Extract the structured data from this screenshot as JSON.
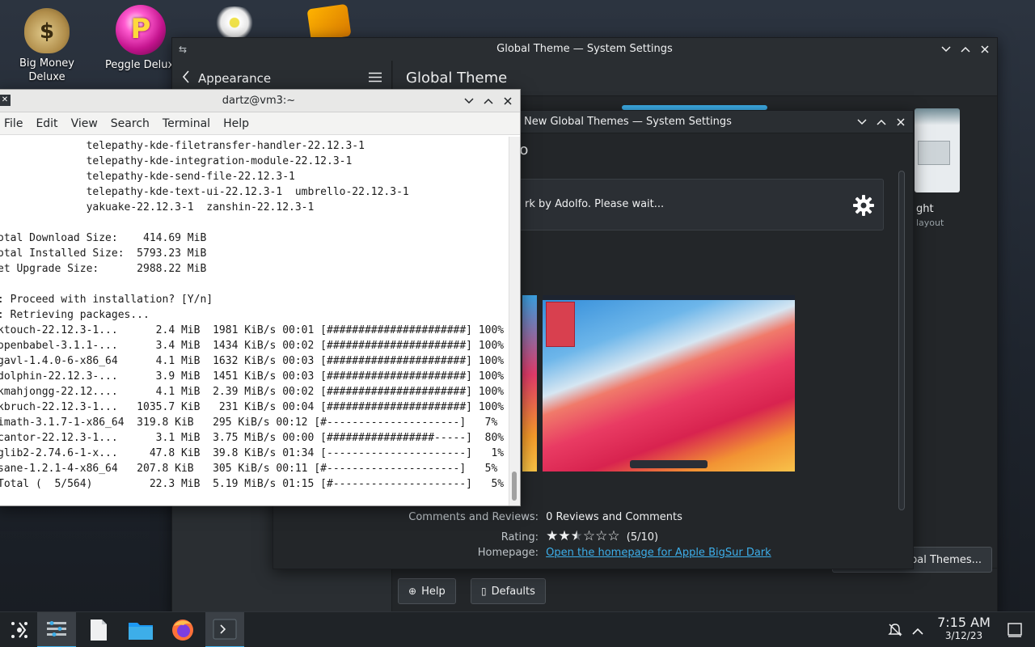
{
  "desktop": {
    "icons": [
      {
        "label": "Big Money Deluxe"
      },
      {
        "label": "Peggle Deluxe"
      }
    ]
  },
  "system_settings": {
    "window_title": "Global Theme — System Settings",
    "sidebar_title": "Appearance",
    "page_title": "Global Theme",
    "right_card_label": "ght",
    "right_card_sublabel": "layout",
    "get_new_button": "obal Themes...",
    "help_button": "Help",
    "defaults_button": "Defaults"
  },
  "ghns_dialog": {
    "window_title": "New Global Themes — System Settings",
    "heading_fragment": "fo",
    "status_message": "rk by Adolfo. Please wait...",
    "comments_label": "Comments and Reviews:",
    "comments_value": "0 Reviews and Comments",
    "rating_label": "Rating:",
    "rating_value": "(5/10)",
    "rating_stars": 2.5,
    "homepage_label": "Homepage:",
    "homepage_link": "Open the homepage for Apple BigSur Dark"
  },
  "konsole": {
    "window_title": "dartz@vm3:~",
    "menu": [
      "File",
      "Edit",
      "View",
      "Search",
      "Terminal",
      "Help"
    ],
    "lines": [
      "              telepathy-kde-filetransfer-handler-22.12.3-1",
      "              telepathy-kde-integration-module-22.12.3-1",
      "              telepathy-kde-send-file-22.12.3-1",
      "              telepathy-kde-text-ui-22.12.3-1  umbrello-22.12.3-1",
      "              yakuake-22.12.3-1  zanshin-22.12.3-1",
      "",
      "otal Download Size:    414.69 MiB",
      "otal Installed Size:  5793.23 MiB",
      "et Upgrade Size:      2988.22 MiB",
      "",
      ": Proceed with installation? [Y/n]",
      ": Retrieving packages...",
      "ktouch-22.12.3-1...      2.4 MiB  1981 KiB/s 00:01 [######################] 100%",
      "openbabel-3.1.1-...      3.4 MiB  1434 KiB/s 00:02 [######################] 100%",
      "gavl-1.4.0-6-x86_64      4.1 MiB  1632 KiB/s 00:03 [######################] 100%",
      "dolphin-22.12.3-...      3.9 MiB  1451 KiB/s 00:03 [######################] 100%",
      "kmahjongg-22.12....      4.1 MiB  2.39 MiB/s 00:02 [######################] 100%",
      "kbruch-22.12.3-1...   1035.7 KiB   231 KiB/s 00:04 [######################] 100%",
      "imath-3.1.7-1-x86_64  319.8 KiB   295 KiB/s 00:12 [#---------------------]   7%",
      "cantor-22.12.3-1...      3.1 MiB  3.75 MiB/s 00:00 [#################-----]  80%",
      "glib2-2.74.6-1-x...     47.8 KiB  39.8 KiB/s 01:34 [----------------------]   1%",
      "sane-1.2.1-4-x86_64   207.8 KiB   305 KiB/s 00:11 [#---------------------]   5%",
      "Total (  5/564)         22.3 MiB  5.19 MiB/s 01:15 [#---------------------]   5%"
    ]
  },
  "taskbar": {
    "time": "7:15 AM",
    "date": "3/12/23"
  },
  "colors": {
    "accent": "#3daee9",
    "window_bg": "#232629",
    "terminal_bg": "#ffffff"
  }
}
